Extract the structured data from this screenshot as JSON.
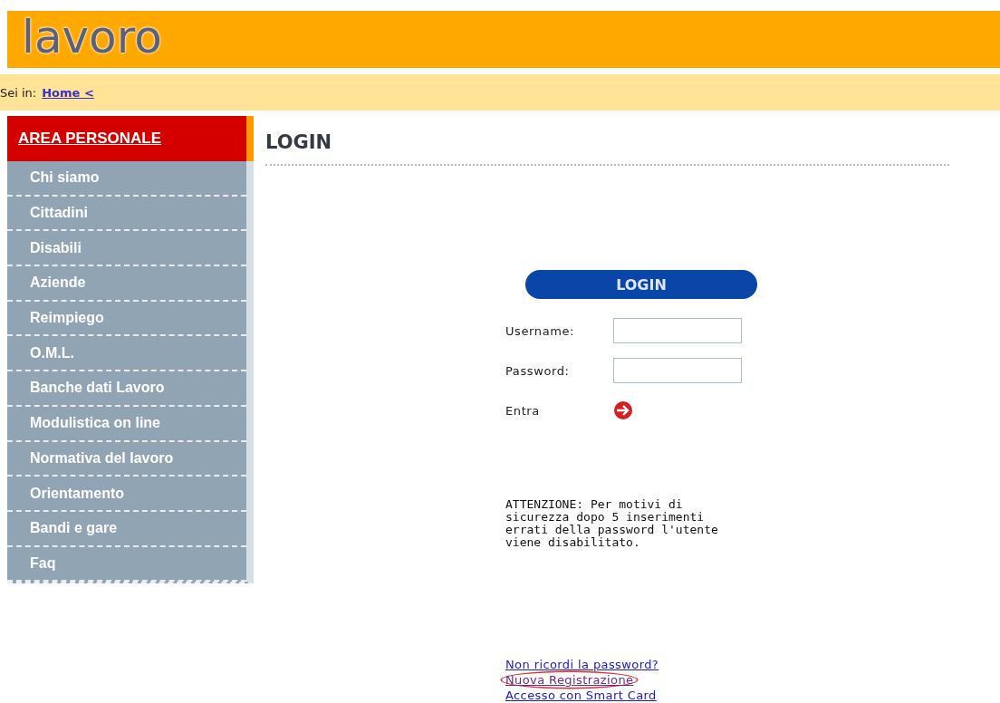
{
  "header": {
    "logo": "lavoro"
  },
  "breadcrumb": {
    "label": "Sei in:",
    "link": "Home <"
  },
  "sidebar": {
    "title": "AREA PERSONALE",
    "items": [
      {
        "label": "Chi siamo"
      },
      {
        "label": "Cittadini"
      },
      {
        "label": "Disabili"
      },
      {
        "label": "Aziende"
      },
      {
        "label": "Reimpiego"
      },
      {
        "label": "O.M.L."
      },
      {
        "label": "Banche dati Lavoro"
      },
      {
        "label": "Modulistica on line"
      },
      {
        "label": "Normativa del lavoro"
      },
      {
        "label": "Orientamento"
      },
      {
        "label": "Bandi e gare"
      },
      {
        "label": "Faq"
      }
    ]
  },
  "page_title": "LOGIN",
  "login": {
    "heading": "LOGIN",
    "fields": [
      {
        "label": "Username:"
      },
      {
        "label": "Password:"
      }
    ],
    "submit_label": "Entra"
  },
  "warning": "ATTENZIONE: Per motivi di sicurezza dopo 5 inserimenti errati della password l'utente viene disabilitato.",
  "links": [
    {
      "label": "Non ricordi la password?",
      "visited": false,
      "highlighted": false
    },
    {
      "label": "Nuova Registrazione",
      "visited": true,
      "highlighted": true
    },
    {
      "label": "Accesso con Smart Card",
      "visited": false,
      "highlighted": false
    }
  ]
}
